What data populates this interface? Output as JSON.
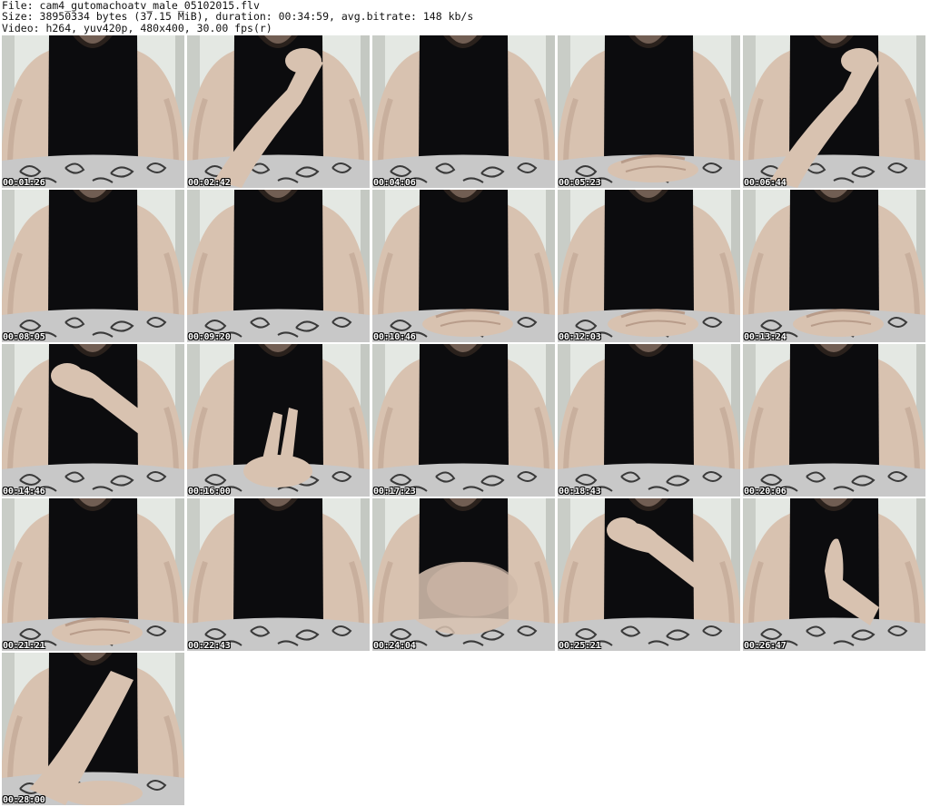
{
  "header": {
    "line1": "File: cam4_gutomachoatv_male_05102015.flv",
    "line2": "Size: 38950334 bytes (37.15 MiB), duration: 00:34:59, avg.bitrate: 148 kb/s",
    "line3": "Video: h264, yuv420p, 480x400, 30.00 fps(r)"
  },
  "thumbnails": [
    {
      "time": "00:01:26",
      "pose": "arms-down"
    },
    {
      "time": "00:02:42",
      "pose": "hand-face"
    },
    {
      "time": "00:04:06",
      "pose": "arms-down"
    },
    {
      "time": "00:05:23",
      "pose": "hands-together"
    },
    {
      "time": "00:06:44",
      "pose": "hand-face"
    },
    {
      "time": "00:08:05",
      "pose": "arms-down"
    },
    {
      "time": "00:09:20",
      "pose": "arms-down"
    },
    {
      "time": "00:10:46",
      "pose": "hands-together"
    },
    {
      "time": "00:12:03",
      "pose": "hands-together"
    },
    {
      "time": "00:13:24",
      "pose": "hands-together"
    },
    {
      "time": "00:14:46",
      "pose": "hand-chest"
    },
    {
      "time": "00:16:00",
      "pose": "fingers-up"
    },
    {
      "time": "00:17:23",
      "pose": "arms-down"
    },
    {
      "time": "00:18:43",
      "pose": "arms-down"
    },
    {
      "time": "00:20:06",
      "pose": "arms-down"
    },
    {
      "time": "00:21:21",
      "pose": "hands-together"
    },
    {
      "time": "00:22:43",
      "pose": "arms-down"
    },
    {
      "time": "00:24:04",
      "pose": "blur-hands"
    },
    {
      "time": "00:25:21",
      "pose": "hand-chest"
    },
    {
      "time": "00:26:47",
      "pose": "hand-beard"
    },
    {
      "time": "00:28:00",
      "pose": "arm-across"
    }
  ],
  "colors": {
    "skin": "#d8c2b0",
    "skin_shadow": "#b89c8a",
    "shirt": "#0c0c0e",
    "beard": "#2a211c",
    "pants": "#c8c8c8",
    "pants_pattern": "#3a3a3a",
    "background": "#e4e8e3"
  }
}
